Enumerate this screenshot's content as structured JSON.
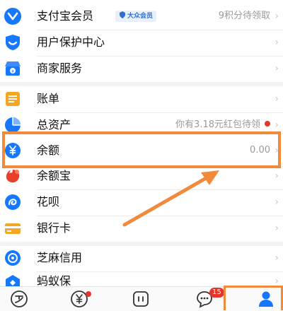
{
  "menu": {
    "member": {
      "label": "支付宝会员",
      "badge": "大众会员",
      "trail": "9积分待领取"
    },
    "protection": {
      "label": "用户保护中心"
    },
    "merchant": {
      "label": "商家服务"
    },
    "bill": {
      "label": "账单"
    },
    "assets": {
      "label": "总资产",
      "trail": "你有3.18元红包待领"
    },
    "balance": {
      "label": "余额",
      "trail": "0.00"
    },
    "yuebao": {
      "label": "余额宝"
    },
    "huabei": {
      "label": "花呗"
    },
    "bankcard": {
      "label": "银行卡"
    },
    "sesame": {
      "label": "芝麻信用"
    },
    "insurance": {
      "label": "蚂蚁保"
    }
  },
  "tabbar": {
    "messages_count": "15"
  },
  "colors": {
    "brand_blue": "#1677ff",
    "highlight_orange": "#f28a3c",
    "badge_red": "#e5352b"
  },
  "icons": [
    "member-icon",
    "shield-icon",
    "store-icon",
    "bill-icon",
    "pie-icon",
    "yuan-icon",
    "yuebao-icon",
    "huabei-icon",
    "bankcard-icon",
    "sesame-icon",
    "insurance-icon",
    "home-tab-icon",
    "wealth-tab-icon",
    "koubei-tab-icon",
    "message-tab-icon",
    "mine-tab-icon"
  ]
}
